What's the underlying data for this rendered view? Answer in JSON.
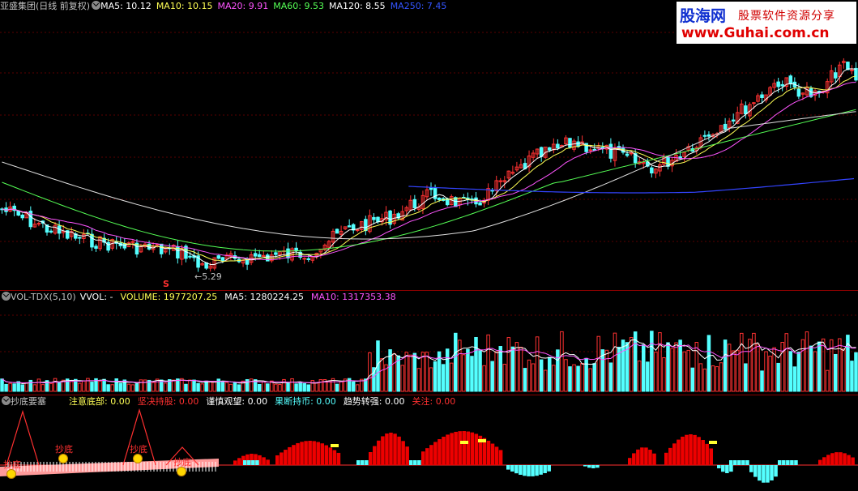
{
  "main": {
    "title": "亚盛集团(日线 前复权)",
    "indicators": [
      {
        "label": "MA5: 10.12",
        "color": "#ffffff"
      },
      {
        "label": "MA10: 10.15",
        "color": "#ffff55"
      },
      {
        "label": "MA20: 9.91",
        "color": "#ff55ff"
      },
      {
        "label": "MA60: 9.53",
        "color": "#55ff55"
      },
      {
        "label": "MA120: 8.55",
        "color": "#ffffff"
      },
      {
        "label": "MA250: 7.45",
        "color": "#3355ff"
      }
    ],
    "low_label": "5.29",
    "s_marker": "S"
  },
  "watermark": {
    "brand": "股海网",
    "slogan": "股票软件资源分享",
    "url": "www.Guhai.com.cn"
  },
  "volume": {
    "name": "VOL-TDX(5,10)",
    "fields": [
      {
        "label": "VVOL: -",
        "color": "#ffffff"
      },
      {
        "label": "VOLUME: 1977207.25",
        "color": "#ffff55"
      },
      {
        "label": "MA5: 1280224.25",
        "color": "#ffffff"
      },
      {
        "label": "MA10: 1317353.38",
        "color": "#ff55ff"
      }
    ]
  },
  "indicator": {
    "name": "抄底要塞",
    "fields": [
      {
        "label": "注意底部: 0.00",
        "color": "#ffff55"
      },
      {
        "label": "坚决持股: 0.00",
        "color": "#ff3030"
      },
      {
        "label": "谨慎观望: 0.00",
        "color": "#ffffff"
      },
      {
        "label": "果断持币: 0.00",
        "color": "#55ffff"
      },
      {
        "label": "趋势转强: 0.00",
        "color": "#ffffff"
      },
      {
        "label": "关注: 0.00",
        "color": "#ff3030"
      }
    ],
    "signal_label": "抄底",
    "signals": [
      {
        "label": "抄底"
      },
      {
        "label": "抄底"
      },
      {
        "label": "抄底"
      },
      {
        "label": "抄底"
      }
    ]
  }
}
